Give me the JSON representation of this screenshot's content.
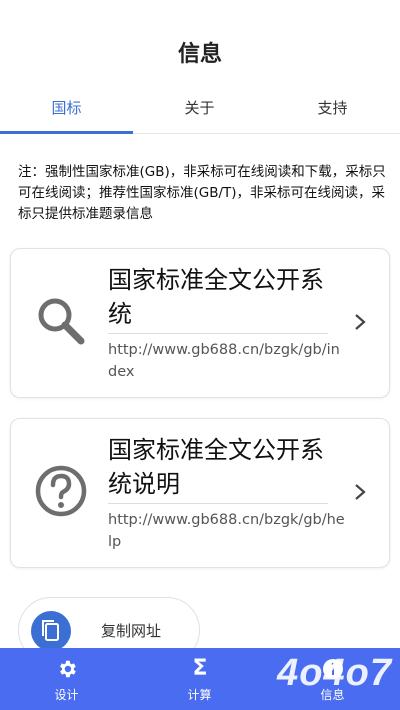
{
  "header": {
    "title": "信息"
  },
  "tabs": [
    {
      "label": "国标",
      "active": true
    },
    {
      "label": "关于",
      "active": false
    },
    {
      "label": "支持",
      "active": false
    }
  ],
  "note": "注：强制性国家标准(GB)，非采标可在线阅读和下载，采标只可在线阅读；推荐性国家标准(GB/T)，非采标可在线阅读，采标只提供标准题录信息",
  "cards": [
    {
      "title": "国家标准全文公开系统",
      "url": "http://www.gb688.cn/bzgk/gb/index",
      "icon": "search-icon"
    },
    {
      "title": "国家标准全文公开系统说明",
      "url": "http://www.gb688.cn/bzgk/gb/help",
      "icon": "help-icon"
    }
  ],
  "copy_button": {
    "label": "复制网址",
    "icon": "copy-icon"
  },
  "bottom_nav": [
    {
      "label": "设计",
      "icon": "gear-icon"
    },
    {
      "label": "计算",
      "icon": "sigma-icon"
    },
    {
      "label": "信息",
      "icon": "info-icon"
    }
  ],
  "watermark": "4o4o7",
  "colors": {
    "accent": "#3b6fd4",
    "nav_bg": "#4a6cf0"
  }
}
